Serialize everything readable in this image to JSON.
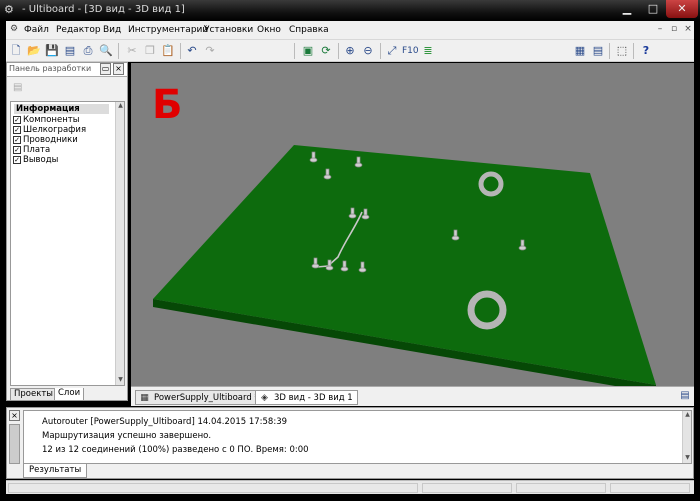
{
  "window": {
    "title": "- Ultiboard - [3D вид - 3D вид 1]"
  },
  "menu": [
    "Файл",
    "Редактор",
    "Вид",
    "Инструментарий",
    "Установки",
    "Окно",
    "Справка"
  ],
  "panel": {
    "title": "Панель разработки",
    "layer_group": "Информация",
    "layers": [
      {
        "label": "Компоненты",
        "checked": true
      },
      {
        "label": "Шелкография",
        "checked": true
      },
      {
        "label": "Проводники",
        "checked": true
      },
      {
        "label": "Плата",
        "checked": true
      },
      {
        "label": "Выводы",
        "checked": true
      }
    ],
    "tabs": [
      "Проекты",
      "Слои"
    ]
  },
  "viewport": {
    "label": "Б",
    "background_color": "#7f7f7f",
    "board_color": "#0d6b0d",
    "board_edge_color": "#064806"
  },
  "doc_tabs": [
    "PowerSupply_Ultiboard *",
    "3D вид - 3D вид 1"
  ],
  "output": {
    "lines": [
      "Autorouter [PowerSupply_Ultiboard]  14.04.2015 17:58:39",
      "Маршрутизация успешно завершено.",
      "12 из 12 соединений (100%) разведено с 0 ПО.  Время: 0:00"
    ],
    "tab": "Результаты"
  }
}
